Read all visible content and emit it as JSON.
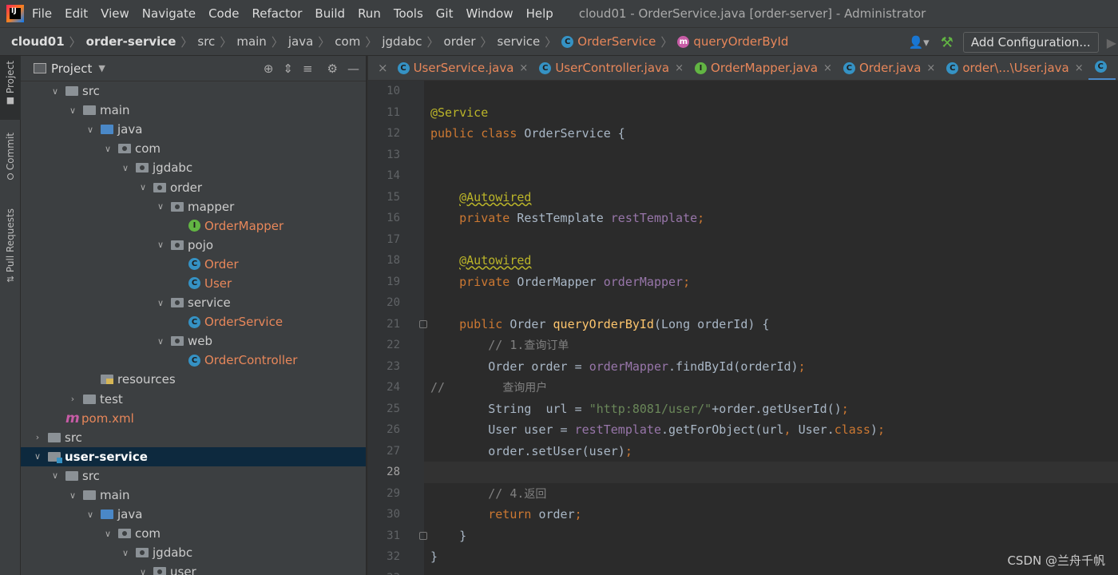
{
  "menubar": {
    "items": [
      "File",
      "Edit",
      "View",
      "Navigate",
      "Code",
      "Refactor",
      "Build",
      "Run",
      "Tools",
      "Git",
      "Window",
      "Help"
    ],
    "title": "cloud01 - OrderService.java [order-server] - Administrator"
  },
  "navbar": {
    "crumbs": [
      "cloud01",
      "order-service",
      "src",
      "main",
      "java",
      "com",
      "jgdabc",
      "order",
      "service"
    ],
    "class_crumb": "OrderService",
    "method_crumb": "queryOrderById",
    "add_config": "Add Configuration..."
  },
  "toolstrip": {
    "tabs": [
      "Project",
      "Commit",
      "Pull Requests"
    ]
  },
  "project": {
    "title": "Project",
    "tree": [
      {
        "label": "src",
        "depth": 2,
        "open": true,
        "kind": "folder"
      },
      {
        "label": "main",
        "depth": 3,
        "open": true,
        "kind": "folder"
      },
      {
        "label": "java",
        "depth": 4,
        "open": true,
        "kind": "src"
      },
      {
        "label": "com",
        "depth": 5,
        "open": true,
        "kind": "pkg"
      },
      {
        "label": "jgdabc",
        "depth": 6,
        "open": true,
        "kind": "pkg"
      },
      {
        "label": "order",
        "depth": 7,
        "open": true,
        "kind": "pkg"
      },
      {
        "label": "mapper",
        "depth": 8,
        "open": true,
        "kind": "pkg"
      },
      {
        "label": "OrderMapper",
        "depth": 9,
        "kind": "iface",
        "err": true
      },
      {
        "label": "pojo",
        "depth": 8,
        "open": true,
        "kind": "pkg"
      },
      {
        "label": "Order",
        "depth": 9,
        "kind": "class",
        "err": true
      },
      {
        "label": "User",
        "depth": 9,
        "kind": "class",
        "err": true
      },
      {
        "label": "service",
        "depth": 8,
        "open": true,
        "kind": "pkg"
      },
      {
        "label": "OrderService",
        "depth": 9,
        "kind": "class",
        "err": true
      },
      {
        "label": "web",
        "depth": 8,
        "open": true,
        "kind": "pkg"
      },
      {
        "label": "OrderController",
        "depth": 9,
        "kind": "class",
        "err": true
      },
      {
        "label": "resources",
        "depth": 4,
        "kind": "res"
      },
      {
        "label": "test",
        "depth": 3,
        "open": false,
        "kind": "folder"
      },
      {
        "label": "pom.xml",
        "depth": 2,
        "kind": "maven",
        "err": true
      },
      {
        "label": "src",
        "depth": 1,
        "open": false,
        "kind": "folder"
      },
      {
        "label": "user-service",
        "depth": 1,
        "open": true,
        "kind": "module",
        "selected": true
      },
      {
        "label": "src",
        "depth": 2,
        "open": true,
        "kind": "folder"
      },
      {
        "label": "main",
        "depth": 3,
        "open": true,
        "kind": "folder"
      },
      {
        "label": "java",
        "depth": 4,
        "open": true,
        "kind": "src"
      },
      {
        "label": "com",
        "depth": 5,
        "open": true,
        "kind": "pkg"
      },
      {
        "label": "jgdabc",
        "depth": 6,
        "open": true,
        "kind": "pkg"
      },
      {
        "label": "user",
        "depth": 7,
        "open": true,
        "kind": "pkg"
      }
    ]
  },
  "editor": {
    "tabs": [
      {
        "label": "UserService.java",
        "icon": "C"
      },
      {
        "label": "UserController.java",
        "icon": "C"
      },
      {
        "label": "OrderMapper.java",
        "icon": "I"
      },
      {
        "label": "Order.java",
        "icon": "C"
      },
      {
        "label": "order\\...\\User.java",
        "icon": "C"
      }
    ],
    "current_line": 28,
    "lines": [
      {
        "n": 10,
        "tokens": []
      },
      {
        "n": 11,
        "tokens": [
          [
            "an",
            "@Service"
          ]
        ]
      },
      {
        "n": 12,
        "tokens": [
          [
            "kw",
            "public class "
          ],
          [
            "pl",
            "OrderService {"
          ]
        ]
      },
      {
        "n": 13,
        "tokens": []
      },
      {
        "n": 14,
        "tokens": []
      },
      {
        "n": 15,
        "tokens": [
          [
            "pl",
            "    "
          ],
          [
            "an u",
            "@Autowired"
          ]
        ]
      },
      {
        "n": 16,
        "tokens": [
          [
            "pl",
            "    "
          ],
          [
            "kw",
            "private "
          ],
          [
            "pl",
            "RestTemplate "
          ],
          [
            "fd",
            "restTemplate"
          ],
          [
            "kw",
            ";"
          ]
        ]
      },
      {
        "n": 17,
        "tokens": []
      },
      {
        "n": 18,
        "tokens": [
          [
            "pl",
            "    "
          ],
          [
            "an u",
            "@Autowired"
          ]
        ]
      },
      {
        "n": 19,
        "tokens": [
          [
            "pl",
            "    "
          ],
          [
            "kw",
            "private "
          ],
          [
            "pl",
            "OrderMapper "
          ],
          [
            "fd",
            "orderMapper"
          ],
          [
            "kw",
            ";"
          ]
        ]
      },
      {
        "n": 20,
        "tokens": []
      },
      {
        "n": 21,
        "tokens": [
          [
            "pl",
            "    "
          ],
          [
            "kw",
            "public "
          ],
          [
            "pl",
            "Order "
          ],
          [
            "mt",
            "queryOrderById"
          ],
          [
            "pl",
            "(Long orderId) {"
          ]
        ]
      },
      {
        "n": 22,
        "tokens": [
          [
            "pl",
            "        "
          ],
          [
            "cm",
            "// 1."
          ],
          [
            "cm-zh",
            "查询订单"
          ]
        ]
      },
      {
        "n": 23,
        "tokens": [
          [
            "pl",
            "        Order order = "
          ],
          [
            "fd",
            "orderMapper"
          ],
          [
            "pl",
            ".findById(orderId)"
          ],
          [
            "kw",
            ";"
          ]
        ]
      },
      {
        "n": 24,
        "tokens": [
          [
            "cm",
            "//        "
          ],
          [
            "cm-zh",
            "查询用户"
          ]
        ]
      },
      {
        "n": 25,
        "tokens": [
          [
            "pl",
            "        String  url = "
          ],
          [
            "st",
            "\"http:8081/user/\""
          ],
          [
            "pl",
            "+order.getUserId()"
          ],
          [
            "kw",
            ";"
          ]
        ]
      },
      {
        "n": 26,
        "tokens": [
          [
            "pl",
            "        User user = "
          ],
          [
            "fd",
            "restTemplate"
          ],
          [
            "pl",
            ".getForObject(url"
          ],
          [
            "kw",
            ", "
          ],
          [
            "pl",
            "User."
          ],
          [
            "kw",
            "class"
          ],
          [
            "pl",
            ")"
          ],
          [
            "kw",
            ";"
          ]
        ]
      },
      {
        "n": 27,
        "tokens": [
          [
            "pl",
            "        order.setUser(user)"
          ],
          [
            "kw",
            ";"
          ]
        ]
      },
      {
        "n": 28,
        "tokens": []
      },
      {
        "n": 29,
        "tokens": [
          [
            "pl",
            "        "
          ],
          [
            "cm",
            "// 4."
          ],
          [
            "cm-zh",
            "返回"
          ]
        ]
      },
      {
        "n": 30,
        "tokens": [
          [
            "pl",
            "        "
          ],
          [
            "kw",
            "return "
          ],
          [
            "pl",
            "order"
          ],
          [
            "kw",
            ";"
          ]
        ]
      },
      {
        "n": 31,
        "tokens": [
          [
            "pl",
            "    }"
          ]
        ]
      },
      {
        "n": 32,
        "tokens": [
          [
            "pl",
            "}"
          ]
        ]
      },
      {
        "n": 33,
        "tokens": []
      }
    ]
  },
  "watermark": "CSDN @兰舟千帆"
}
